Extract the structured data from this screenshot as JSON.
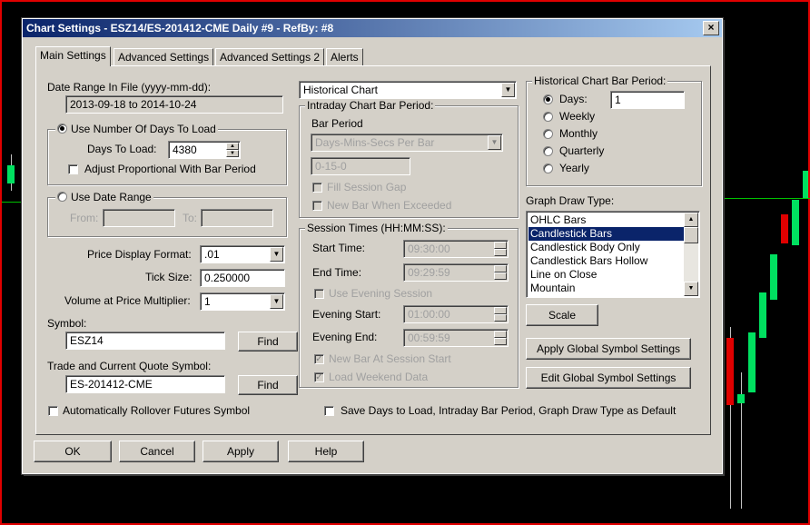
{
  "window": {
    "title": "Chart Settings - ESZ14/ES-201412-CME  Daily  #9 - RefBy: #8",
    "close": "×"
  },
  "tabs": [
    "Main Settings",
    "Advanced Settings",
    "Advanced Settings 2",
    "Alerts"
  ],
  "date_range": {
    "label": "Date Range In File (yyyy-mm-dd):",
    "value": "2013-09-18 to 2014-10-24"
  },
  "days_group": {
    "legend": "Use Number Of Days To Load",
    "days_label": "Days To Load:",
    "days_value": "4380",
    "adjust_label": "Adjust Proportional With Bar Period"
  },
  "date_group": {
    "legend": "Use Date Range",
    "from_label": "From:",
    "to_label": "To:"
  },
  "price_format": {
    "label": "Price Display Format:",
    "value": ".01"
  },
  "tick_size": {
    "label": "Tick Size:",
    "value": "0.250000"
  },
  "volume_mult": {
    "label": "Volume at Price Multiplier:",
    "value": "1"
  },
  "symbol": {
    "label": "Symbol:",
    "value": "ESZ14",
    "find": "Find"
  },
  "trade_symbol": {
    "label": "Trade and Current Quote Symbol:",
    "value": "ES-201412-CME",
    "find": "Find"
  },
  "rollover": "Automatically Rollover Futures Symbol",
  "chart_type": {
    "value": "Historical Chart"
  },
  "intraday": {
    "legend": "Intraday Chart Bar Period:",
    "bar_period_label": "Bar Period",
    "bar_period_value": "Days-Mins-Secs Per Bar",
    "period_value": "0-15-0",
    "fill_gap": "Fill Session Gap",
    "new_bar": "New Bar When Exceeded"
  },
  "session": {
    "legend": "Session Times (HH:MM:SS):",
    "start_label": "Start Time:",
    "start_value": "09:30:00",
    "end_label": "End Time:",
    "end_value": "09:29:59",
    "use_evening": "Use Evening Session",
    "eve_start_label": "Evening Start:",
    "eve_start_value": "01:00:00",
    "eve_end_label": "Evening End:",
    "eve_end_value": "00:59:59",
    "new_bar_start": "New Bar At Session Start",
    "load_weekend": "Load Weekend Data"
  },
  "historical": {
    "legend": "Historical Chart Bar Period:",
    "days_label": "Days:",
    "days_value": "1",
    "weekly": "Weekly",
    "monthly": "Monthly",
    "quarterly": "Quarterly",
    "yearly": "Yearly"
  },
  "graph_draw": {
    "label": "Graph Draw Type:",
    "items": [
      "OHLC Bars",
      "Candlestick Bars",
      "Candlestick Body Only",
      "Candlestick Bars Hollow",
      "Line on Close",
      "Mountain"
    ]
  },
  "scale_btn": "Scale",
  "apply_global": "Apply Global Symbol Settings",
  "edit_global": "Edit Global Symbol Settings",
  "save_default": "Save Days to Load, Intraday Bar Period, Graph Draw Type as Default",
  "buttons": {
    "ok": "OK",
    "cancel": "Cancel",
    "apply": "Apply",
    "help": "Help"
  }
}
